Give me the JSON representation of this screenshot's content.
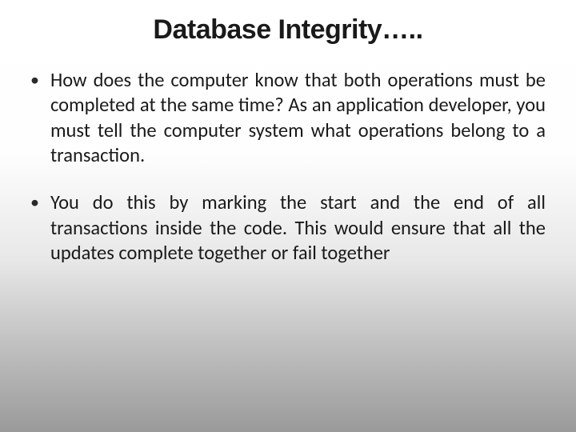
{
  "slide": {
    "title": "Database Integrity…..",
    "bullets": [
      {
        "marker": "•",
        "text": "How does the computer know that both operations must be completed at the same time?  As an application developer, you must tell the computer system what operations belong to a transaction."
      },
      {
        "marker": "•",
        "text": "You do this by marking the start and the end of all transactions inside the code.  This would ensure that all the updates complete together or fail together"
      }
    ]
  }
}
